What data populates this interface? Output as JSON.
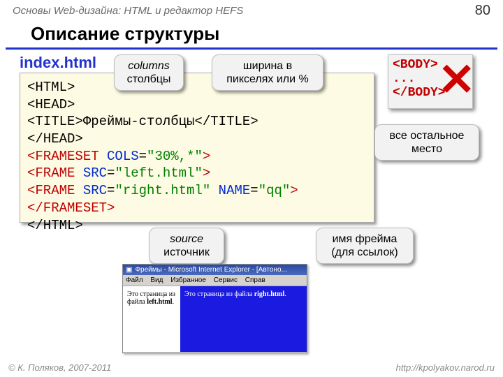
{
  "header": {
    "breadcrumb": "Основы Web-дизайна: HTML и редактор HEFS",
    "page": "80"
  },
  "title": "Описание структуры",
  "subtitle": "index.html",
  "code": {
    "l1a": "<HTML>",
    "l2a": "<HEAD>",
    "l3a": "   <TITLE>",
    "l3b": "Фреймы-столбцы",
    "l3c": "</TITLE>",
    "l4a": "</HEAD>",
    "l5a": "<FRAMESET",
    "l5b": " COLS",
    "l5c": "=",
    "l5d": "\"30%,*\"",
    "l5e": ">",
    "l6a": "   <FRAME",
    "l6b": " SRC",
    "l6c": "=",
    "l6d": "\"left.html\"",
    "l6e": ">",
    "l7a": "   <FRAME",
    "l7b": " SRC",
    "l7c": "=",
    "l7d": "\"right.html\"",
    "l7e": " NAME",
    "l7f": "=",
    "l7g": "\"qq\"",
    "l7h": ">",
    "l8a": "</FRAMESET>",
    "l9a": "</HTML>"
  },
  "callouts": {
    "columns1": "columns",
    "columns2": "столбцы",
    "width": "ширина в пикселях или %",
    "rest": "все остальное место",
    "source1": "source",
    "source2": "источник",
    "name": "имя фрейма (для ссылок)"
  },
  "bodybox": {
    "l1": "<BODY>",
    "l2": "...",
    "l3": "</BODY>"
  },
  "browser": {
    "title": "Фреймы - Microsoft Internet Explorer - [Автоно...",
    "menu": [
      "Файл",
      "Вид",
      "Избранное",
      "Сервис",
      "Справ"
    ],
    "left1": "Это страница из файла",
    "leftb": "left.html",
    "right1": "Это страница из файла",
    "rightb": "right.html"
  },
  "footer": {
    "left": "© К. Поляков, 2007-2011",
    "right": "http://kpolyakov.narod.ru"
  }
}
